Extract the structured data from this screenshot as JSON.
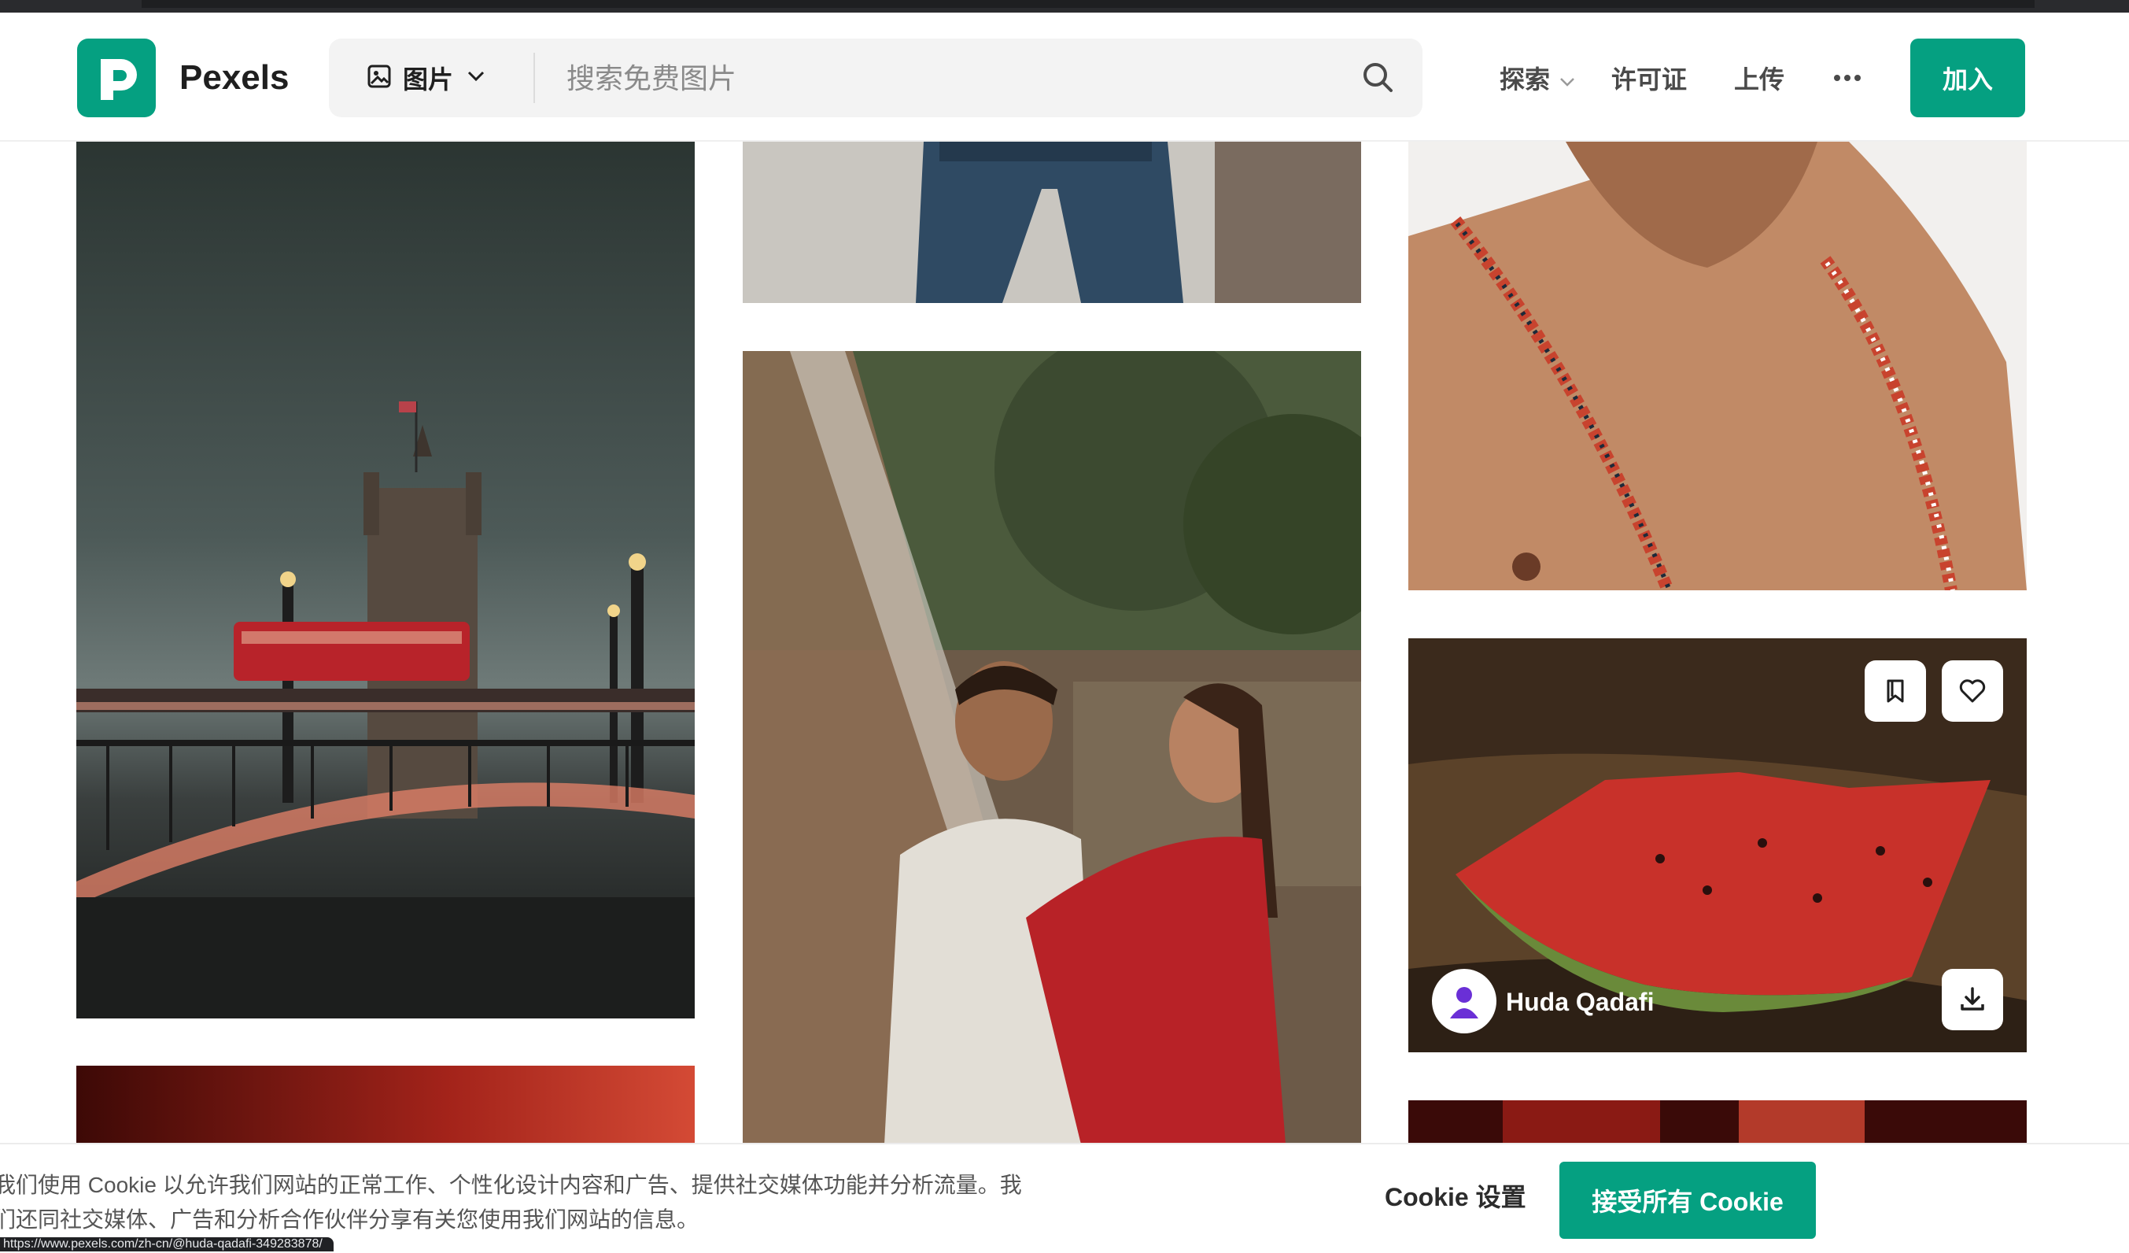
{
  "header": {
    "logo_text": "Pexels",
    "search_type_label": "图片",
    "search_placeholder": "搜索免费图片",
    "nav_explore": "探索",
    "nav_license": "许可证",
    "nav_upload": "上传",
    "join_label": "加入"
  },
  "hovered_photo": {
    "photographer": "Huda Qadafi"
  },
  "cookie": {
    "text": "我们使用 Cookie 以允许我们网站的正常工作、个性化设计内容和广告、提供社交媒体功能并分析流量。我们还同社交媒体、广告和分析合作伙伴分享有关您使用我们网站的信息。",
    "settings_label": "Cookie 设置",
    "accept_label": "接受所有 Cookie"
  },
  "status_bar": {
    "url": "https://www.pexels.com/zh-cn/@huda-qadafi-349283878/"
  },
  "colors": {
    "brand": "#05a081",
    "search_bg": "#f3f3f3"
  },
  "icons": [
    "pexels-logo-icon",
    "image-icon",
    "chevron-down-icon",
    "search-icon",
    "more-icon",
    "bookmark-icon",
    "heart-icon",
    "download-icon",
    "user-avatar-icon"
  ]
}
